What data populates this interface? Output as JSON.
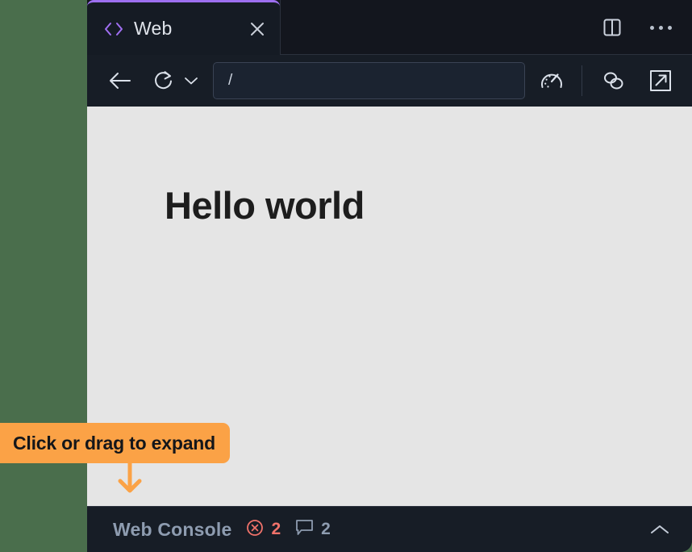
{
  "window": {
    "background_color": "#4a6e4c",
    "chrome_color": "#171d26"
  },
  "tab_strip": {
    "active_tab": {
      "icon": "code-brackets-icon",
      "label": "Web",
      "accent_color": "#9d6ff0",
      "close_icon": "close-icon"
    },
    "actions": [
      {
        "icon": "split-panel-icon",
        "name": "split-panel-button"
      },
      {
        "icon": "more-options-icon",
        "name": "more-options-button"
      }
    ]
  },
  "toolbar": {
    "back_icon": "arrow-left-icon",
    "reload_icon": "reload-icon",
    "reload_menu_icon": "chevron-down-icon",
    "url": {
      "value": "/",
      "placeholder": "/"
    },
    "performance_icon": "speedometer-icon",
    "link_icon": "chain-link-icon",
    "popout_icon": "external-link-icon"
  },
  "page": {
    "heading": "Hello world",
    "background_color": "#e5e5e5"
  },
  "console": {
    "title": "Web Console",
    "error_icon": "error-circle-icon",
    "error_count": "2",
    "message_icon": "message-bubble-icon",
    "message_count": "2",
    "error_color": "#f0726a",
    "toggle_icon": "chevron-up-icon"
  },
  "callout": {
    "text": "Click or drag to expand",
    "color": "#fba246",
    "arrow_icon": "arrow-down-icon"
  }
}
